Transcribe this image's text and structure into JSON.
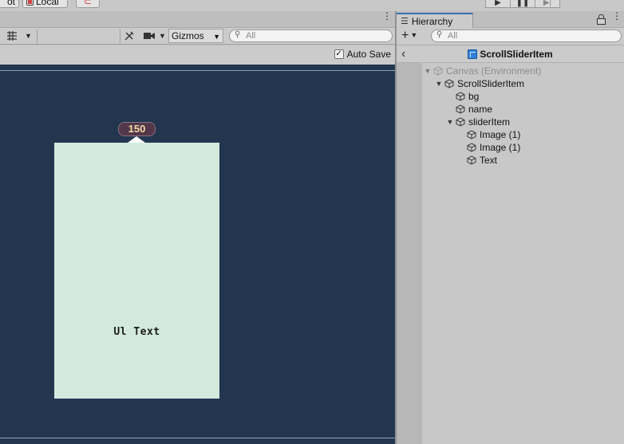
{
  "toolbar": {
    "pivot_label": "ot",
    "local_label": "Local"
  },
  "scene": {
    "gizmos_label": "Gizmos",
    "search_placeholder": "All",
    "autosave_label": "Auto Save",
    "autosave_checked": true,
    "slider_value": "150",
    "ui_text": "Ul Text"
  },
  "hierarchy": {
    "tab_label": "Hierarchy",
    "search_placeholder": "All",
    "header_title": "ScrollSliderItem",
    "items": [
      {
        "label": "Canvas (Environment)",
        "depth": 0,
        "expanded": true,
        "dim": true
      },
      {
        "label": "ScrollSliderItem",
        "depth": 1,
        "expanded": true,
        "dim": false
      },
      {
        "label": "bg",
        "depth": 2,
        "expanded": null,
        "dim": false
      },
      {
        "label": "name",
        "depth": 2,
        "expanded": null,
        "dim": false
      },
      {
        "label": "sliderItem",
        "depth": 2,
        "expanded": true,
        "dim": false
      },
      {
        "label": "Image (1)",
        "depth": 3,
        "expanded": null,
        "dim": false
      },
      {
        "label": "Image (1)",
        "depth": 3,
        "expanded": null,
        "dim": false
      },
      {
        "label": "Text",
        "depth": 3,
        "expanded": null,
        "dim": false
      }
    ]
  },
  "colors": {
    "viewport_bg": "#22374f",
    "card_bg": "#d3e9de",
    "badge_bg": "#53374a",
    "badge_text": "#f3d9a5",
    "tab_accent": "#3a72b0",
    "prefab_blue": "#2f7fd6"
  },
  "icons": {
    "play": "play-icon",
    "pause": "pause-icon",
    "step": "step-icon",
    "lock": "lock-icon",
    "search": "search-icon",
    "gameobject": "cube-icon"
  }
}
